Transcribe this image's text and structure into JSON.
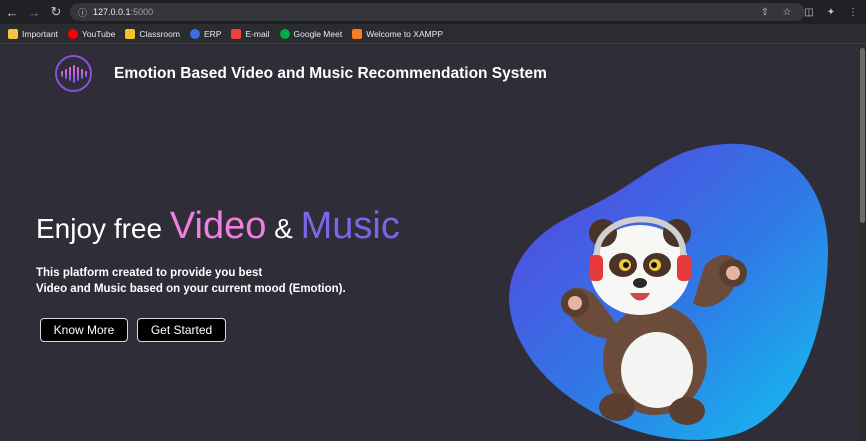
{
  "browser": {
    "url_host": "127.0.0.1",
    "url_port": ":5000",
    "bookmarks": [
      {
        "label": "Important",
        "color": "#f4c542"
      },
      {
        "label": "YouTube",
        "color": "#ff0000"
      },
      {
        "label": "Classroom",
        "color": "#f6c12b"
      },
      {
        "label": "ERP",
        "color": "#3b6ee0"
      },
      {
        "label": "E-mail",
        "color": "#ea4335"
      },
      {
        "label": "Google Meet",
        "color": "#00ac47"
      },
      {
        "label": "Welcome to XAMPP",
        "color": "#fb7a24"
      }
    ]
  },
  "site": {
    "title": "Emotion Based Video and Music Recommendation System"
  },
  "hero": {
    "headline_part1": "Enjoy free ",
    "headline_video": "Video",
    "headline_amp": " & ",
    "headline_music": "Music",
    "subtitle_line1": "This platform created to provide you best",
    "subtitle_line2": "Video and Music based on your current mood (Emotion).",
    "btn_know_more": "Know More",
    "btn_get_started": "Get Started"
  },
  "colors": {
    "page_bg": "#2f2e38",
    "accent_pink": "#f07fe0",
    "accent_purple": "#7a66e8",
    "blob_start": "#5b3fe0",
    "blob_end": "#12c2f0"
  }
}
